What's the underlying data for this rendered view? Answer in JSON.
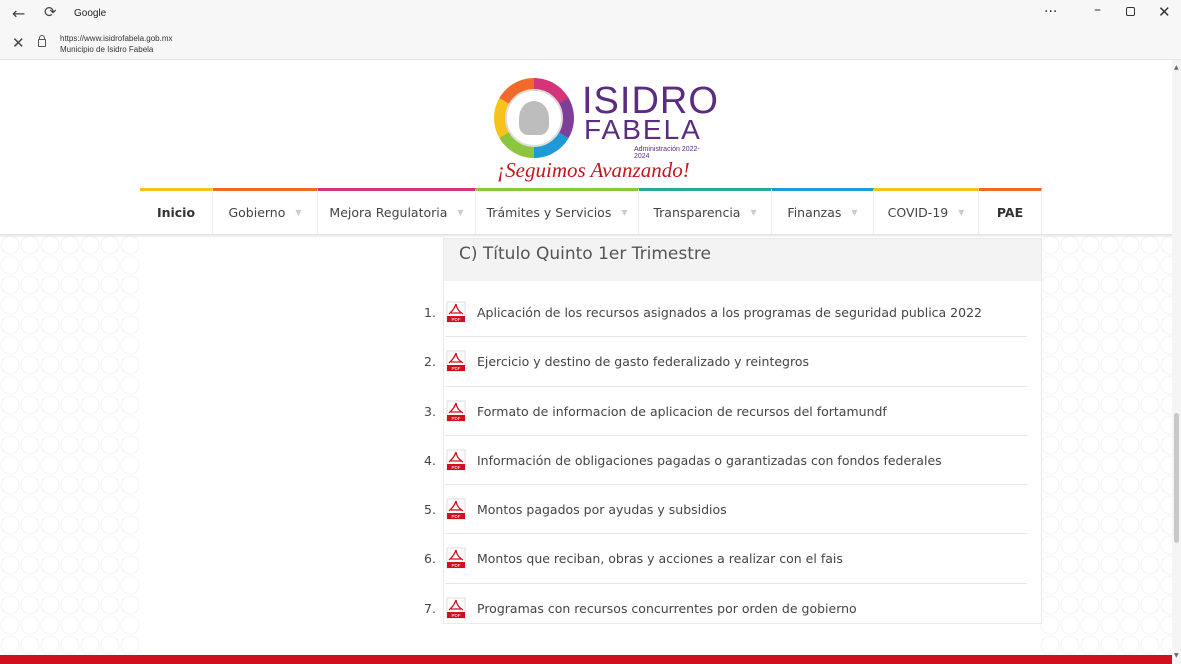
{
  "browser": {
    "tab_title": "Google",
    "url": "https://www.isidrofabela.gob.mx",
    "site_name": "Municipio de Isidro Fabela",
    "more_label": "···"
  },
  "logo": {
    "line1": "ISIDRO",
    "line2": "FABELA",
    "admin": "Administración 2022-2024",
    "slogan": "¡Seguimos Avanzando!"
  },
  "nav": {
    "items": [
      {
        "label": "Inicio",
        "accent": "#f7c21b",
        "has_caret": false,
        "bold": true
      },
      {
        "label": "Gobierno",
        "accent": "#f16a2c",
        "has_caret": true,
        "bold": false
      },
      {
        "label": "Mejora Regulatoria",
        "accent": "#d4357a",
        "has_caret": true,
        "bold": false
      },
      {
        "label": "Trámites y Servicios",
        "accent": "#8cc63f",
        "has_caret": true,
        "bold": false
      },
      {
        "label": "Transparencia",
        "accent": "#2aa69a",
        "has_caret": true,
        "bold": false
      },
      {
        "label": "Finanzas",
        "accent": "#1f9ad6",
        "has_caret": true,
        "bold": false
      },
      {
        "label": "COVID-19",
        "accent": "#f7c21b",
        "has_caret": true,
        "bold": false
      },
      {
        "label": "PAE",
        "accent": "#f16a2c",
        "has_caret": false,
        "bold": true
      }
    ]
  },
  "section": {
    "title": "C) Título Quinto 1er Trimestre",
    "documents": [
      {
        "num": "1.",
        "label": "Aplicación de los recursos asignados a los programas de seguridad publica 2022"
      },
      {
        "num": "2.",
        "label": "Ejercicio y destino de gasto federalizado y reintegros"
      },
      {
        "num": "3.",
        "label": "Formato de informacion de aplicacion de recursos del fortamundf"
      },
      {
        "num": "4.",
        "label": "Información de obligaciones pagadas o garantizadas con fondos federales"
      },
      {
        "num": "5.",
        "label": "Montos pagados por ayudas y subsidios"
      },
      {
        "num": "6.",
        "label": "Montos que reciban, obras y acciones a realizar con el fais"
      },
      {
        "num": "7.",
        "label": "Programas con recursos concurrentes por orden de gobierno"
      }
    ]
  },
  "colors": {
    "brand_purple": "#5a2d82",
    "slogan_red": "#c4161c",
    "footer_red": "#d0101c"
  }
}
